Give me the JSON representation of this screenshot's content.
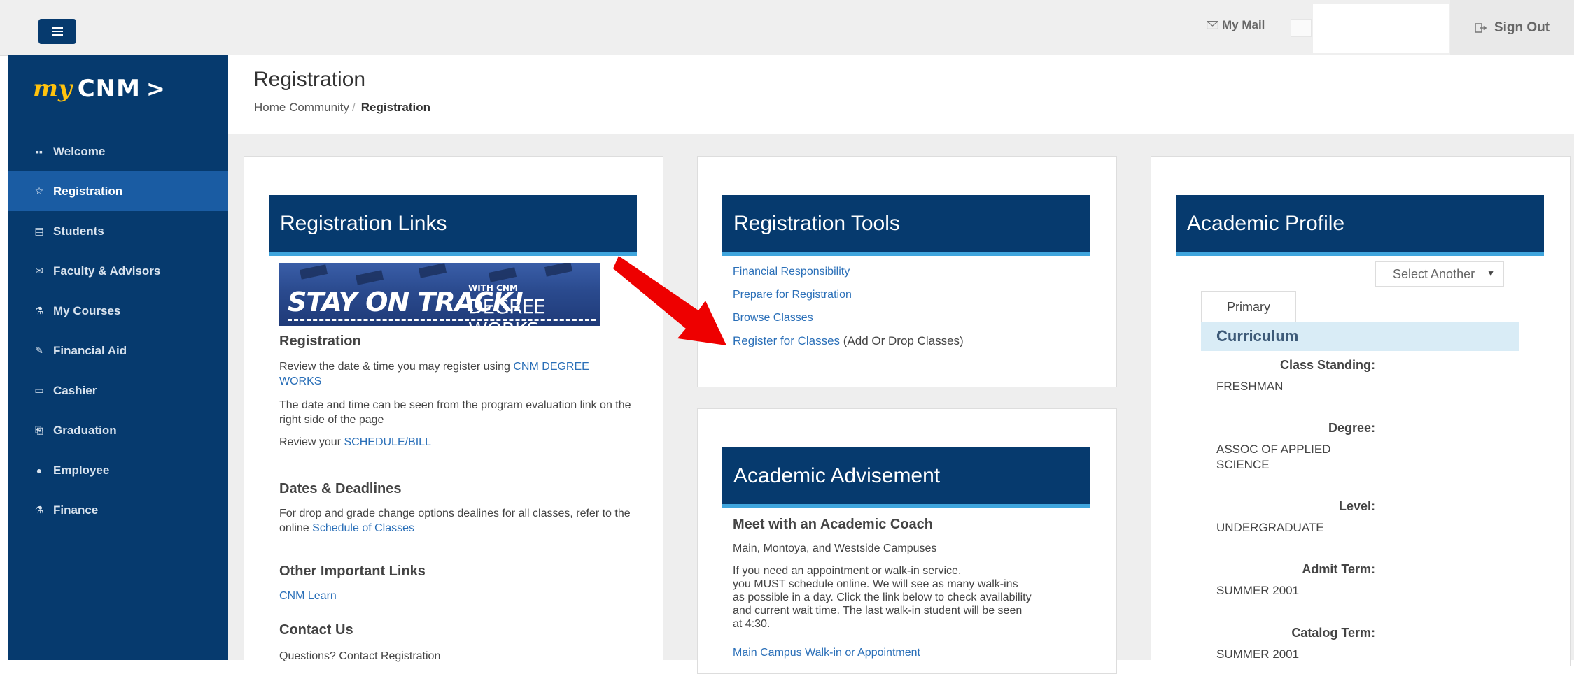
{
  "topbar": {
    "mail_label": "My Mail",
    "signout_label": "Sign Out"
  },
  "logo": {
    "my": "my",
    "cnm": "CNM",
    "chevron": ">"
  },
  "sidebar": {
    "items": [
      {
        "label": "Welcome",
        "icon": "grid-icon",
        "glyph": "▪▪"
      },
      {
        "label": "Registration",
        "icon": "star-icon",
        "glyph": "☆",
        "active": true
      },
      {
        "label": "Students",
        "icon": "chart-icon",
        "glyph": "▤"
      },
      {
        "label": "Faculty & Advisors",
        "icon": "envelope-icon",
        "glyph": "✉"
      },
      {
        "label": "My Courses",
        "icon": "flask-icon",
        "glyph": "⚗"
      },
      {
        "label": "Financial Aid",
        "icon": "edit-icon",
        "glyph": "✎"
      },
      {
        "label": "Cashier",
        "icon": "monitor-icon",
        "glyph": "▭"
      },
      {
        "label": "Graduation",
        "icon": "certificate-icon",
        "glyph": "⎘"
      },
      {
        "label": "Employee",
        "icon": "globe-icon",
        "glyph": "●"
      },
      {
        "label": "Finance",
        "icon": "flask-icon",
        "glyph": "⚗"
      }
    ]
  },
  "header": {
    "title": "Registration",
    "breadcrumb": {
      "home": "Home Community",
      "separator": "/",
      "current": "Registration"
    }
  },
  "registration_links": {
    "title": "Registration Links",
    "banner": {
      "line1": "STAY ON TRACK!",
      "line2": "WITH CNM",
      "line3": "DEGREE WORKS"
    },
    "registration_heading": "Registration",
    "reg_text_prefix": "Review the date & time you may register using ",
    "reg_link": "CNM DEGREE WORKS",
    "reg_text2": "The date and time can be seen from the program evaluation link on the right side of the page",
    "review_prefix": "Review your ",
    "schedule_link": "SCHEDULE/BILL",
    "dates_heading": "Dates & Deadlines",
    "dates_text": "For drop and grade change options dealines for all classes, refer to the online ",
    "dates_link": "Schedule of Classes",
    "other_heading": "Other Important Links",
    "learn_link": "CNM Learn",
    "contact_heading": "Contact Us",
    "contact_partial": "Questions? Contact Registration"
  },
  "registration_tools": {
    "title": "Registration Tools",
    "links": [
      "Financial Responsibility",
      "Prepare for Registration",
      "Browse Classes"
    ],
    "register_link": "Register for Classes",
    "register_suffix": " (Add Or Drop Classes)"
  },
  "academic_advisement": {
    "title": "Academic Advisement",
    "heading": "Meet with an Academic Coach",
    "campuses": "Main, Montoya, and Westside Campuses",
    "line1": "If you need an appointment or walk-in service,",
    "line2": "you MUST schedule online.  We will see as many walk-ins",
    "line3": "as possible in a day. Click the link below to check availability",
    "line4": "and current wait time. The last walk-in student will be seen",
    "line5": "at 4:30.",
    "link": "Main Campus Walk-in or Appointment"
  },
  "academic_profile": {
    "title": "Academic Profile",
    "select_value": "Select Another",
    "tab": "Primary",
    "section": "Curriculum",
    "fields": [
      {
        "label": "Class Standing:",
        "value": "FRESHMAN"
      },
      {
        "label": "Degree:",
        "value": "ASSOC OF APPLIED SCIENCE"
      },
      {
        "label": "Level:",
        "value": "UNDERGRADUATE"
      },
      {
        "label": "Admit Term:",
        "value": "SUMMER 2001"
      },
      {
        "label": "Catalog Term:",
        "value": "SUMMER 2001"
      }
    ]
  },
  "colors": {
    "navy": "#063a6e",
    "active_nav": "#1a5ca3",
    "accent_blue": "#3fa5dd",
    "link": "#2a6fb8",
    "arrow": "#ee0000",
    "logo_yellow": "#ffc20e"
  }
}
